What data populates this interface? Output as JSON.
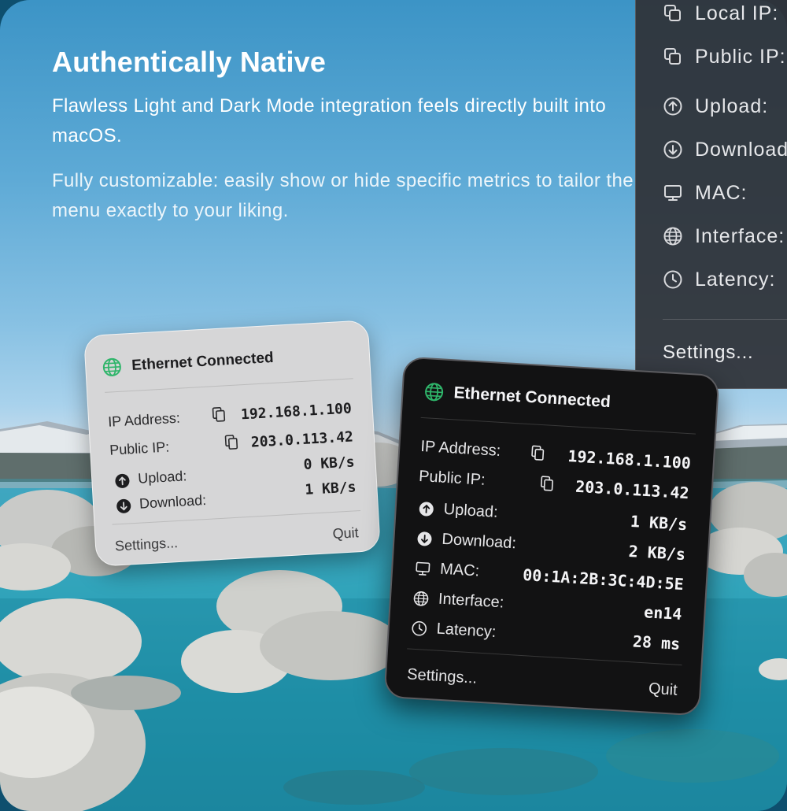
{
  "headline": "Authentically Native",
  "paragraphs": [
    "Flawless Light and Dark Mode integration feels directly built into macOS.",
    "Fully customizable: easily show or hide specific metrics to tailor the menu exactly to your liking."
  ],
  "side_menu": {
    "items": [
      {
        "label": "Local IP:",
        "icon": "copy-icon"
      },
      {
        "label": "Public IP:",
        "icon": "copy-icon"
      },
      {
        "label": "Upload:",
        "icon": "arrow-up-circle-icon"
      },
      {
        "label": "Download:",
        "icon": "arrow-down-circle-icon"
      },
      {
        "label": "MAC:",
        "icon": "monitor-icon"
      },
      {
        "label": "Interface:",
        "icon": "globe-icon"
      },
      {
        "label": "Latency:",
        "icon": "clock-icon"
      }
    ],
    "settings": "Settings..."
  },
  "light_card": {
    "title": "Ethernet Connected",
    "rows": [
      {
        "label": "IP Address:",
        "value": "192.168.1.100",
        "icon": "copy-icon"
      },
      {
        "label": "Public IP:",
        "value": "203.0.113.42",
        "icon": "copy-icon"
      },
      {
        "label": "Upload:",
        "value": "0 KB/s",
        "icon": "arrow-up-circle-icon"
      },
      {
        "label": "Download:",
        "value": "1 KB/s",
        "icon": "arrow-down-circle-icon"
      }
    ],
    "settings": "Settings...",
    "quit": "Quit"
  },
  "dark_card": {
    "title": "Ethernet Connected",
    "rows": [
      {
        "label": "IP Address:",
        "value": "192.168.1.100",
        "icon": "copy-icon"
      },
      {
        "label": "Public IP:",
        "value": "203.0.113.42",
        "icon": "copy-icon"
      },
      {
        "label": "Upload:",
        "value": "1 KB/s",
        "icon": "arrow-up-circle-icon"
      },
      {
        "label": "Download:",
        "value": "2 KB/s",
        "icon": "arrow-down-circle-icon"
      },
      {
        "label": "MAC:",
        "value": "00:1A:2B:3C:4D:5E",
        "icon": "monitor-icon"
      },
      {
        "label": "Interface:",
        "value": "en14",
        "icon": "globe-icon"
      },
      {
        "label": "Latency:",
        "value": "28 ms",
        "icon": "clock-icon"
      }
    ],
    "settings": "Settings...",
    "quit": "Quit"
  },
  "colors": {
    "status_green": "#2fb56a",
    "sky": "#5eaad6",
    "water": "#1e8fa6"
  }
}
